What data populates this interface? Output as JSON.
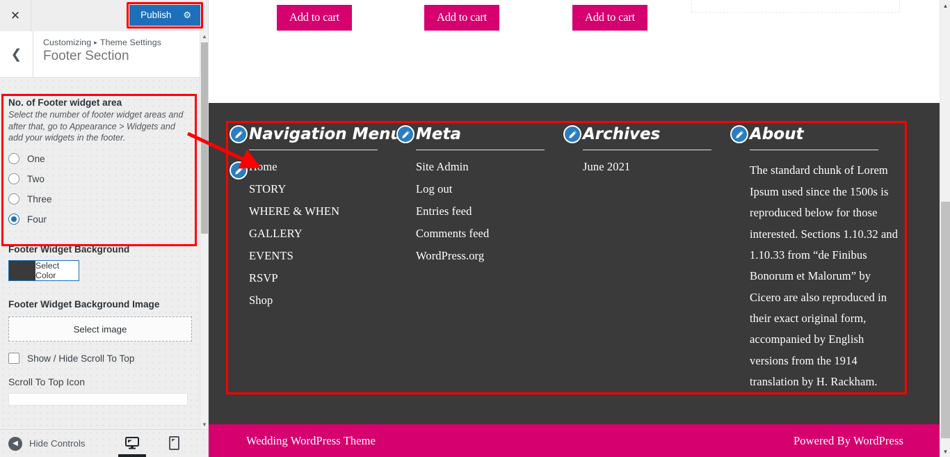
{
  "customizer": {
    "close_icon": "close-icon",
    "publish_label": "Publish",
    "publish_gear_icon": "gear-icon",
    "back_icon": "chevron-left-icon",
    "breadcrumb_root": "Customizing",
    "breadcrumb_sep": "▸",
    "breadcrumb_parent": "Theme Settings",
    "section_title": "Footer Section",
    "controls": {
      "footer_widget_area": {
        "label": "No. of Footer widget area",
        "description": "Select the number of footer widget areas and after that, go to Appearance > Widgets and add your widgets in the footer.",
        "options": [
          "One",
          "Two",
          "Three",
          "Four"
        ],
        "selected": "Four"
      },
      "footer_widget_background": {
        "label": "Footer Widget Background",
        "button_label": "Select Color",
        "swatch_color": "#3a3a3a"
      },
      "footer_widget_background_image": {
        "label": "Footer Widget Background Image",
        "button_label": "Select image"
      },
      "scroll_to_top_toggle": {
        "label": "Show / Hide Scroll To Top",
        "checked": false
      },
      "scroll_to_top_icon": {
        "label": "Scroll To Top Icon",
        "value": ""
      }
    },
    "footer_bar": {
      "hide_controls_label": "Hide Controls",
      "hide_controls_icon": "collapse-arrow-icon",
      "devices": [
        {
          "name": "desktop",
          "icon": "desktop-icon",
          "active": true
        },
        {
          "name": "tablet",
          "icon": "tablet-icon",
          "active": false
        },
        {
          "name": "mobile",
          "icon": "mobile-icon",
          "active": false
        }
      ]
    },
    "accent_color": "#1e6fba",
    "highlight_color": "#ff0000"
  },
  "preview": {
    "add_to_cart_label": "Add to cart",
    "add_to_cart_count": 3,
    "footer_background": "#3a3a3a",
    "brand_pink": "#d6006e",
    "widgets": [
      {
        "title": "Navigation Menu",
        "type": "list",
        "items": [
          "Home",
          "STORY",
          "WHERE & WHEN",
          "GALLERY",
          "EVENTS",
          "RSVP",
          "Shop"
        ]
      },
      {
        "title": "Meta",
        "type": "list",
        "items": [
          "Site Admin",
          "Log out",
          "Entries feed",
          "Comments feed",
          "WordPress.org"
        ]
      },
      {
        "title": "Archives",
        "type": "list",
        "items": [
          "June 2021"
        ]
      },
      {
        "title": "About",
        "type": "text",
        "text": "The standard chunk of Lorem Ipsum used since the 1500s is reproduced below for those interested. Sections 1.10.32 and 1.10.33 from “de Finibus Bonorum et Malorum” by Cicero are also reproduced in their exact original form, accompanied by English versions from the 1914 translation by H. Rackham."
      }
    ],
    "bottom_bar": {
      "left_text": "Wedding WordPress Theme",
      "right_text": "Powered By WordPress"
    },
    "edit_pin_icon": "pencil-edit-icon"
  }
}
